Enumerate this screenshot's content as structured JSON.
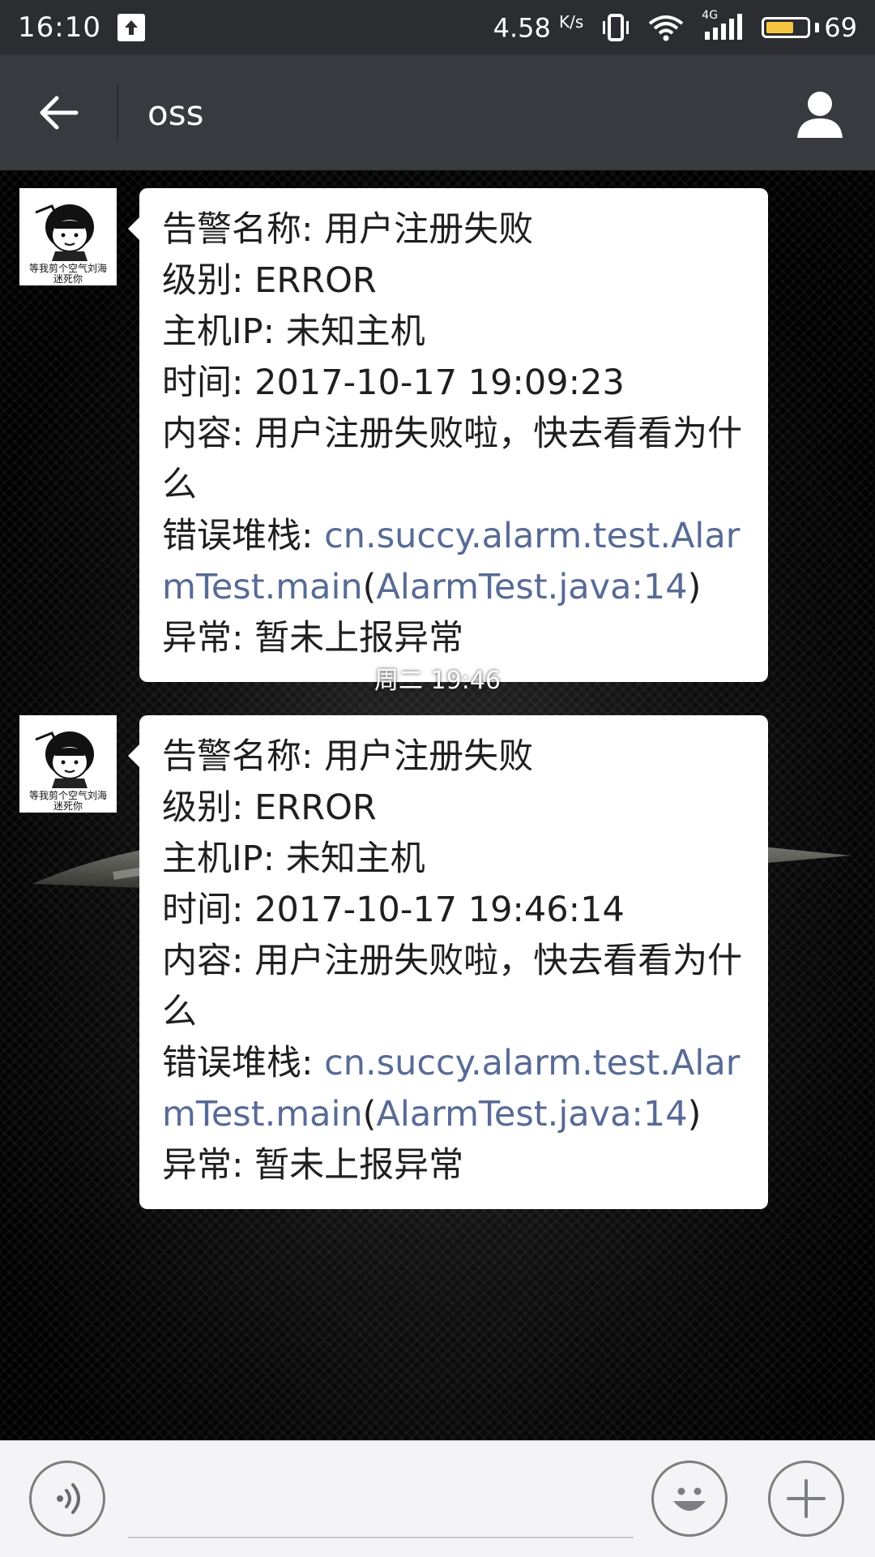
{
  "status_bar": {
    "time": "16:10",
    "network_speed": "4.58",
    "network_speed_unit": "K/s",
    "network_type": "4G",
    "battery_level": "69",
    "icons": [
      "upload-icon",
      "vibrate-icon",
      "wifi-icon",
      "signal-icon",
      "battery-icon"
    ],
    "battery_color": "#f5c542"
  },
  "header": {
    "title": "oss",
    "back_icon": "arrow-left-icon",
    "profile_icon": "person-icon"
  },
  "messages": [
    {
      "avatar_caption_line1": "等我剪个空气刘海",
      "avatar_caption_line2": "迷死你",
      "alarm_name_label": "告警名称: ",
      "alarm_name": "用户注册失败",
      "level_label": "级别: ",
      "level": "ERROR",
      "host_label": "主机IP: ",
      "host": "未知主机",
      "time_label": "时间: ",
      "time": "2017-10-17 19:09:23",
      "content_label": "内容: ",
      "content": "用户注册失败啦，快去看看为什么",
      "stack_label": "错误堆栈: ",
      "stack_link1": "cn.succy.alarm.test.AlarmTest.main",
      "stack_paren_open": "(",
      "stack_link2": "AlarmTest.java:14",
      "stack_paren_close": ")",
      "exception_label": "异常: ",
      "exception": "暂未上报异常"
    },
    {
      "avatar_caption_line1": "等我剪个空气刘海",
      "avatar_caption_line2": "迷死你",
      "alarm_name_label": "告警名称: ",
      "alarm_name": "用户注册失败",
      "level_label": "级别: ",
      "level": "ERROR",
      "host_label": "主机IP: ",
      "host": "未知主机",
      "time_label": "时间: ",
      "time": "2017-10-17 19:46:14",
      "content_label": "内容: ",
      "content": "用户注册失败啦，快去看看为什么",
      "stack_label": "错误堆栈: ",
      "stack_link1": "cn.succy.alarm.test.AlarmTest.main",
      "stack_paren_open": "(",
      "stack_link2": "AlarmTest.java:14",
      "stack_paren_close": ")",
      "exception_label": "异常: ",
      "exception": "暂未上报异常"
    }
  ],
  "timestamp_divider": "周二 19:46",
  "input_bar": {
    "placeholder": "",
    "voice_icon": "voice-icon",
    "emoji_icon": "emoji-icon",
    "plus_icon": "plus-icon"
  },
  "colors": {
    "header_bg": "#393a3f",
    "status_bg": "#2b2d30",
    "link": "#576b95",
    "bubble_bg": "#ffffff"
  }
}
